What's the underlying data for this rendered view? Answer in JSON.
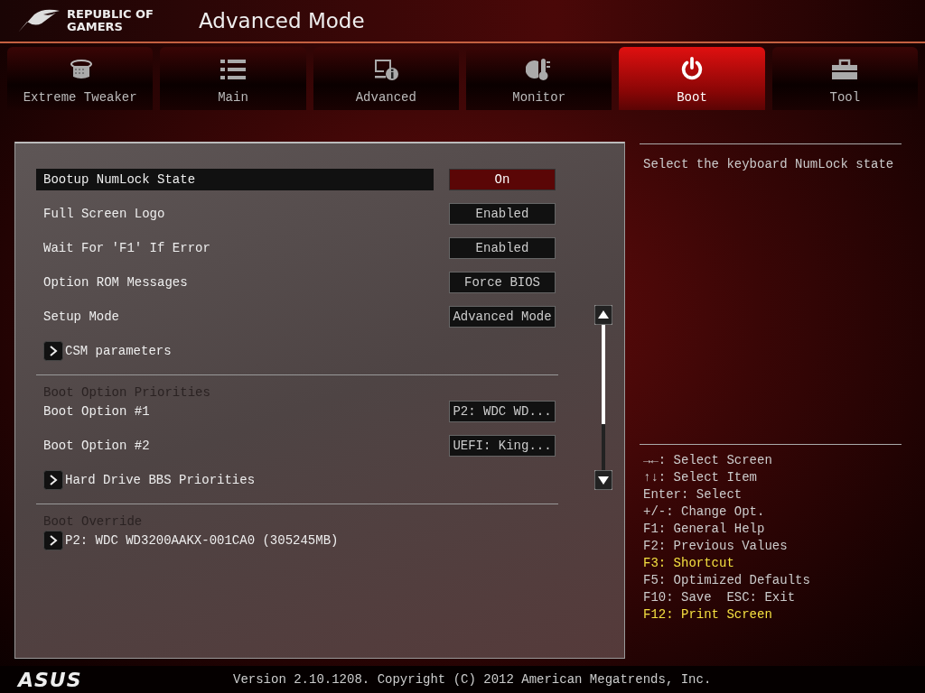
{
  "header": {
    "brand_line1": "REPUBLIC OF",
    "brand_line2": "GAMERS",
    "title": "Advanced Mode"
  },
  "tabs": [
    {
      "kind": "tweaker",
      "label": "Extreme Tweaker",
      "selected": false
    },
    {
      "kind": "main",
      "label": "Main",
      "selected": false
    },
    {
      "kind": "advanced",
      "label": "Advanced",
      "selected": false
    },
    {
      "kind": "monitor",
      "label": "Monitor",
      "selected": false
    },
    {
      "kind": "boot",
      "label": "Boot",
      "selected": true
    },
    {
      "kind": "tool",
      "label": "Tool",
      "selected": false
    }
  ],
  "settings": {
    "sections": [
      {
        "blocks": [
          [
            {
              "kind": "option",
              "label": "Bootup NumLock State",
              "value": "On",
              "selected": true
            }
          ],
          [
            {
              "kind": "option",
              "label": "Full Screen Logo",
              "value": "Enabled",
              "selected": false
            },
            {
              "kind": "option",
              "label": "Wait For 'F1' If Error",
              "value": "Enabled",
              "selected": false
            },
            {
              "kind": "option",
              "label": "Option ROM Messages",
              "value": "Force BIOS",
              "selected": false
            },
            {
              "kind": "option",
              "label": "Setup Mode",
              "value": "Advanced Mode",
              "selected": false
            },
            {
              "kind": "submenu",
              "label": "CSM parameters",
              "selected": false
            }
          ]
        ]
      },
      {
        "heading": "Boot Option Priorities",
        "blocks": [
          [
            {
              "kind": "option",
              "label": "Boot Option #1",
              "value": "P2: WDC WD...",
              "selected": false
            },
            {
              "kind": "option",
              "label": "Boot Option #2",
              "value": "UEFI: King...",
              "selected": false
            }
          ],
          [
            {
              "kind": "submenu",
              "label": "Hard Drive BBS Priorities",
              "selected": false
            }
          ]
        ]
      },
      {
        "heading": "Boot Override",
        "blocks": [
          [
            {
              "kind": "submenu",
              "label": "P2: WDC WD3200AAKX-001CA0  (305245MB)",
              "selected": false
            }
          ]
        ]
      }
    ]
  },
  "help": {
    "description": "Select the keyboard NumLock state",
    "keys": [
      {
        "text": "→←: Select Screen",
        "highlighted": false
      },
      {
        "text": "↑↓: Select Item",
        "highlighted": false
      },
      {
        "text": "Enter: Select",
        "highlighted": false
      },
      {
        "text": "+/-: Change Opt.",
        "highlighted": false
      },
      {
        "text": "F1: General Help",
        "highlighted": false
      },
      {
        "text": "F2: Previous Values",
        "highlighted": false
      },
      {
        "text": "F3: Shortcut",
        "highlighted": true
      },
      {
        "text": "F5: Optimized Defaults",
        "highlighted": false
      },
      {
        "text": "F10: Save  ESC: Exit",
        "highlighted": false
      },
      {
        "text": "F12: Print Screen",
        "highlighted": true
      }
    ]
  },
  "footer": {
    "logo": "ASUS",
    "version": "Version 2.10.1208. Copyright (C) 2012 American Megatrends, Inc."
  }
}
